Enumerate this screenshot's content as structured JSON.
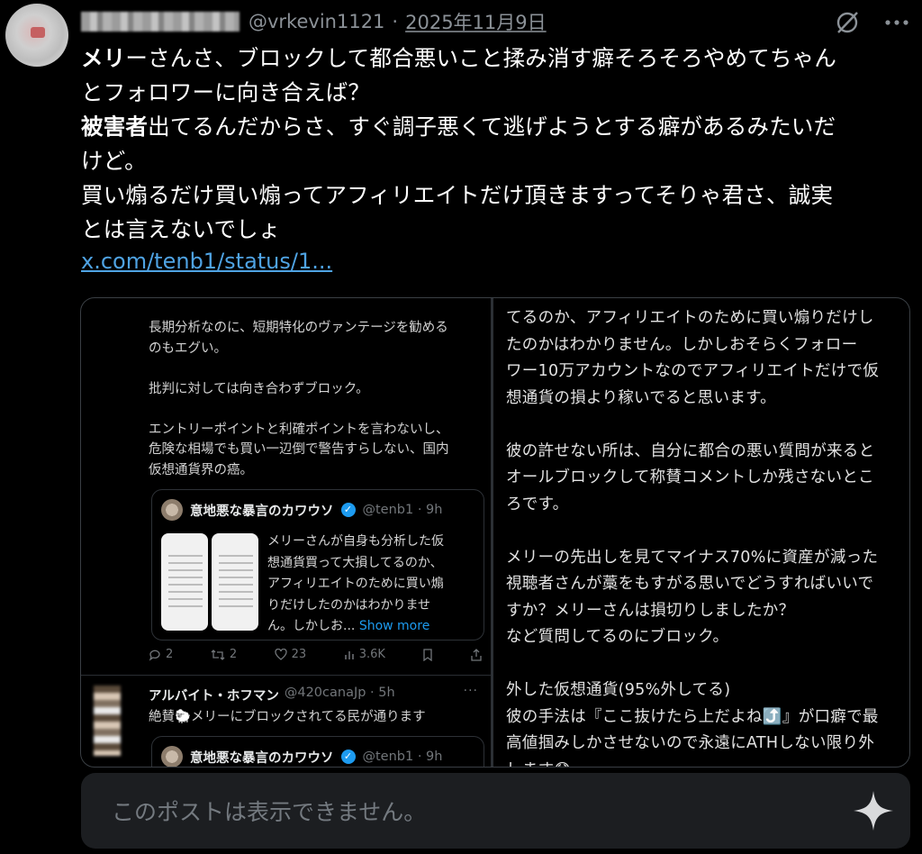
{
  "header": {
    "display_name": "Kevin",
    "handle": "@vrkevin1121",
    "separator": "·",
    "date": "2025年11月9日"
  },
  "tweet": {
    "line1_bold": "メリ",
    "line1_rest": "ーさんさ、ブロックして都合悪いこと揉み消す癖そろそろやめてちゃん",
    "line2": "とフォロワーに向き合えば？",
    "line3_bold": "被害者",
    "line3_rest": "出てるんだからさ、すぐ調子悪くて逃げようとする癖があるみたいだ",
    "line4": "けど。",
    "line5": "買い煽るだけ買い煽ってアフィリエイトだけ頂きますってそりゃ君さ、誠実",
    "line6": "とは言えないでしょ",
    "link": "x.com/tenb1/status/1..."
  },
  "media": {
    "left": {
      "text": "長期分析なのに、短期特化のヴァンテージを勧める\nのもエグい。\n\n批判に対しては向き合わずブロック。\n\nエントリーポイントと利確ポイントを言わないし、\n危険な相場でも買い一辺倒で警告すらしない、国内\n仮想通貨界の癌。",
      "quote": {
        "name": "意地悪な暴言のカワウソ",
        "handle": "@tenb1 · 9h",
        "text": "メリーさんが自身も分析した仮\n想通貨買って大損してるのか、\nアフィリエイトのために買い煽\nりだけしたのかはわかりませ\nん。しかしお...",
        "more": "Show more"
      },
      "actions": {
        "replies": "2",
        "reposts": "2",
        "likes": "23",
        "views": "3.6K"
      },
      "reply": {
        "name": "アルバイト・ホフマン",
        "handle": "@420canaJp · 5h",
        "more": "···",
        "text": "絶賛🐑メリーにブロックされてる民が通ります",
        "quote_name": "意地悪な暴言のカワウソ",
        "quote_handle": "@tenb1 · 9h"
      }
    },
    "right_text": "てるのか、アフィリエイトのために買い煽りだけし\nたのかはわかりません。しかしおそらくフォロー\nワー10万アカウントなのでアフィリエイトだけで仮\n想通貨の損より稼いでると思います。\n\n彼の許せない所は、自分に都合の悪い質問が来ると\nオールブロックして称賛コメントしか残さないとこ\nろです。\n\nメリーの先出しを見てマイナス70%に資産が減った\n視聴者さんが藁をもすがる思いでどうすればいいで\nすか？メリーさんは損切りしましたか？\nなど質問してるのにブロック。\n\n外した仮想通貨(95%外してる)\n彼の手法は『ここ抜けたら上だよね⤴️』が口癖で最\n高値掴みしかさせないので永遠にATHしない限り外\nします😓"
  },
  "composer": {
    "placeholder": "このポストは表示できません。"
  },
  "colors": {
    "background": "#000000",
    "link": "#4fa3e3",
    "muted": "#8b9197",
    "composer_bg": "#1c1e21"
  },
  "icons": [
    "grok-slash-icon",
    "more-horizontal-icon",
    "reply-icon",
    "repost-icon",
    "like-icon",
    "views-icon",
    "bookmark-icon",
    "share-icon",
    "sparkle-icon"
  ]
}
